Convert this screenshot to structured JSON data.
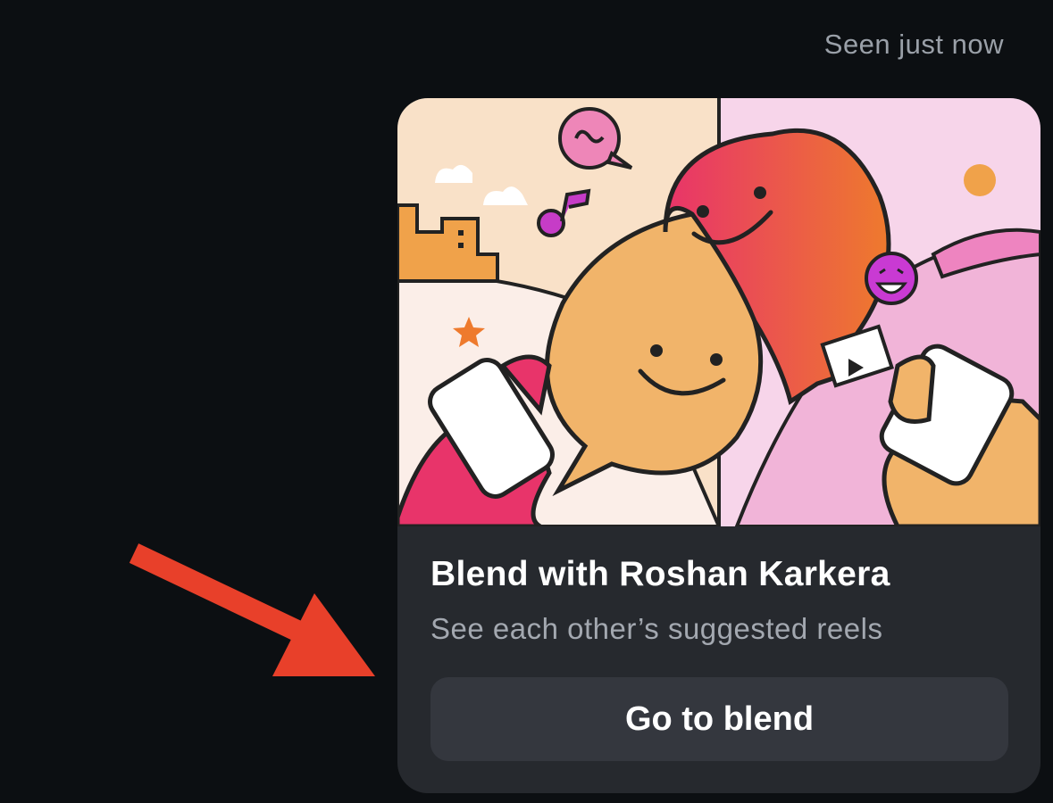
{
  "message": {
    "seen_status": "Seen just now"
  },
  "blend_card": {
    "title": "Blend with Roshan Karkera",
    "subtitle": "See each other’s suggested reels",
    "button_label": "Go to blend"
  },
  "colors": {
    "background": "#0c0f12",
    "card": "#26292e",
    "button": "#34373e",
    "arrow": "#e8402a"
  }
}
